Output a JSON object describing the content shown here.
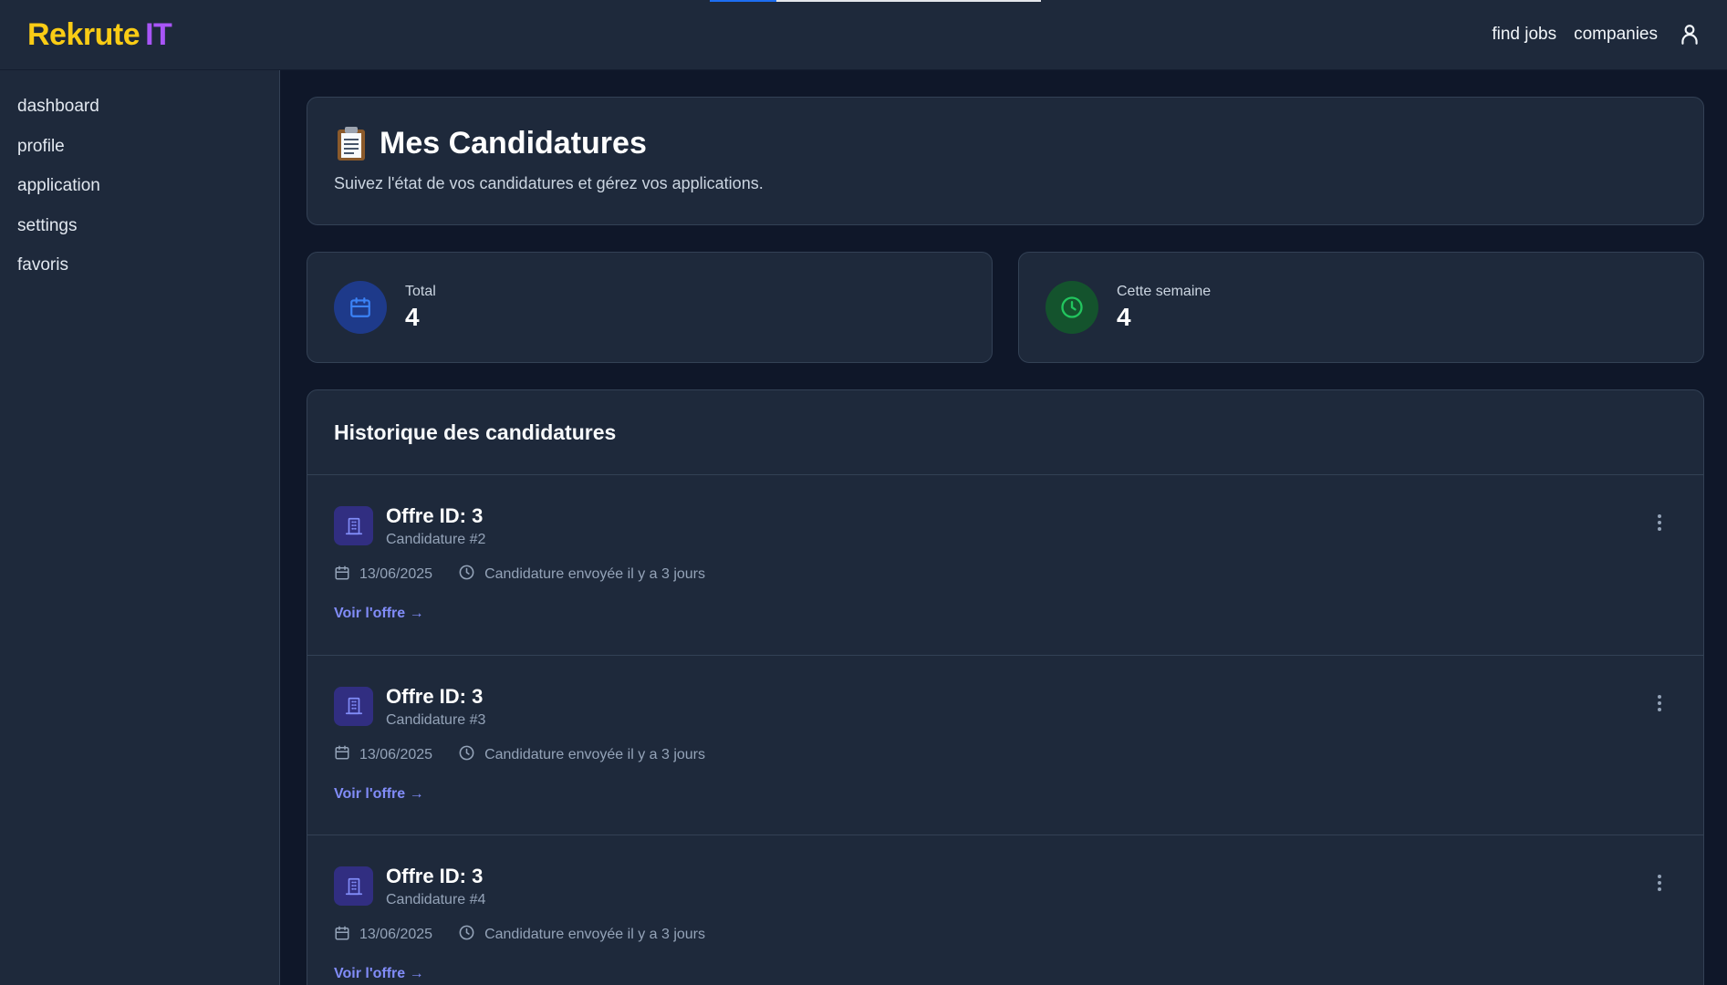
{
  "brand": {
    "name_part1": "Rekrute",
    "name_part2": "IT",
    "color_primary": "#facc15",
    "color_secondary": "#a855f7"
  },
  "topnav": {
    "find_jobs": "find jobs",
    "companies": "companies",
    "user_icon": "user-icon"
  },
  "sidebar": {
    "items": [
      {
        "label": "dashboard"
      },
      {
        "label": "profile"
      },
      {
        "label": "application"
      },
      {
        "label": "settings"
      },
      {
        "label": "favoris"
      }
    ]
  },
  "header": {
    "icon": "clipboard-icon",
    "title": "Mes Candidatures",
    "subtitle": "Suivez l'état de vos candidatures et gérez vos applications."
  },
  "stats": [
    {
      "label": "Total",
      "value": "4",
      "icon": "calendar-icon",
      "color": "#3b82f6"
    },
    {
      "label": "Cette semaine",
      "value": "4",
      "icon": "clock-icon",
      "color": "#22c55e"
    }
  ],
  "history": {
    "title": "Historique des candidatures",
    "items": [
      {
        "title": "Offre ID: 3",
        "subtitle": "Candidature #2",
        "date": "13/06/2025",
        "status": "Candidature envoyée il y a 3 jours",
        "link": "Voir l'offre →"
      },
      {
        "title": "Offre ID: 3",
        "subtitle": "Candidature #3",
        "date": "13/06/2025",
        "status": "Candidature envoyée il y a 3 jours",
        "link": "Voir l'offre →"
      },
      {
        "title": "Offre ID: 3",
        "subtitle": "Candidature #4",
        "date": "13/06/2025",
        "status": "Candidature envoyée il y a 3 jours",
        "link": "Voir l'offre →"
      }
    ]
  },
  "colors": {
    "page_bg": "#0f1729",
    "card_bg": "#1e293b",
    "link": "#818cf8"
  }
}
